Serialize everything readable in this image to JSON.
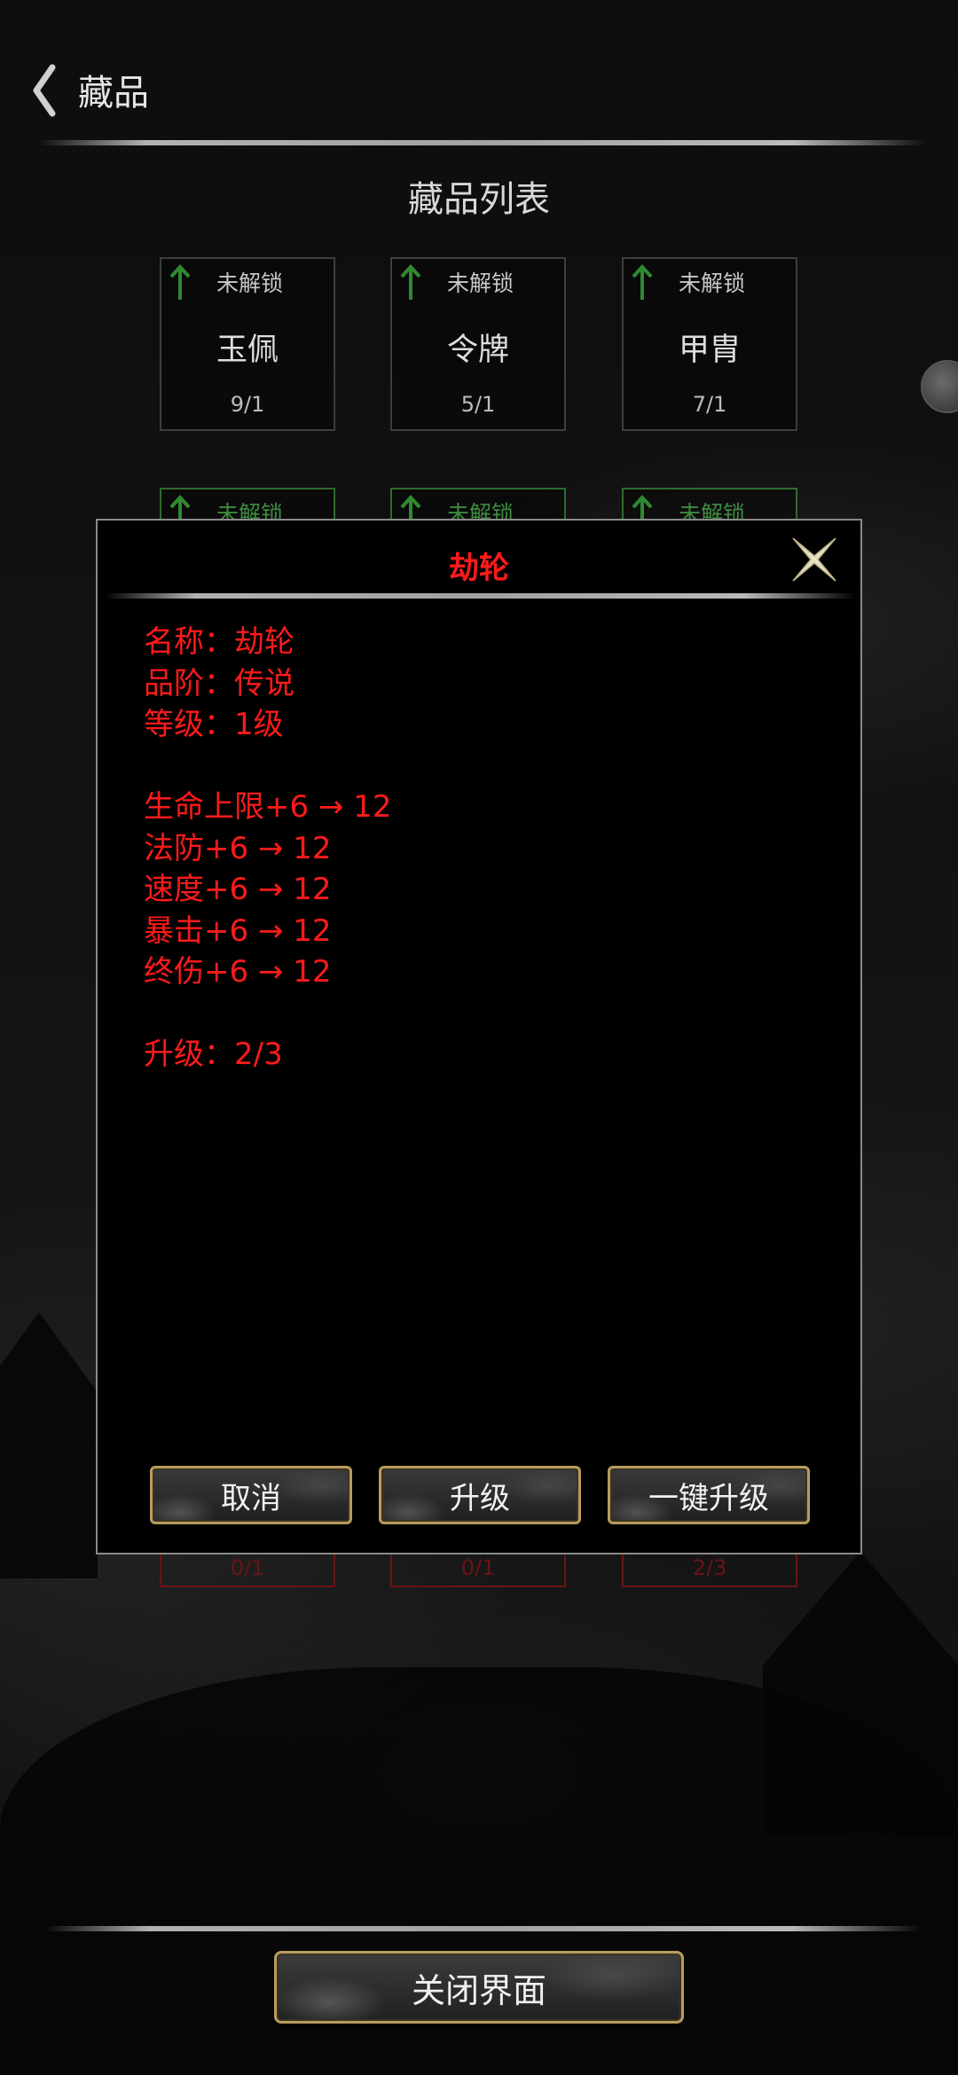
{
  "header": {
    "title": "藏品",
    "back_icon": "chevron-left-icon"
  },
  "list": {
    "title": "藏品列表",
    "row1": [
      {
        "status": "未解锁",
        "name": "玉佩",
        "count": "9/1"
      },
      {
        "status": "未解锁",
        "name": "令牌",
        "count": "5/1"
      },
      {
        "status": "未解锁",
        "name": "甲胄",
        "count": "7/1"
      }
    ],
    "row2": [
      {
        "status": "未解锁"
      },
      {
        "status": "未解锁"
      },
      {
        "status": "未解锁"
      }
    ],
    "hidden_row_counts": [
      "0/1",
      "0/1",
      "2/3"
    ]
  },
  "modal": {
    "title": "劫轮",
    "close_icon": "close-icon",
    "lines_info": [
      "名称：劫轮",
      "品阶：传说",
      "等级：1级"
    ],
    "lines_stats": [
      "生命上限+6 → 12",
      "法防+6 → 12",
      "速度+6 → 12",
      "暴击+6 → 12",
      "终伤+6 → 12"
    ],
    "upgrade_progress": "升级：2/3",
    "buttons": {
      "cancel": "取消",
      "upgrade": "升级",
      "upgrade_all": "一键升级"
    }
  },
  "footer": {
    "close_label": "关闭界面"
  },
  "colors": {
    "accent_red": "#ff1a1a",
    "unlock_green": "#2f8a2f",
    "gold_border": "#b89c5e"
  }
}
